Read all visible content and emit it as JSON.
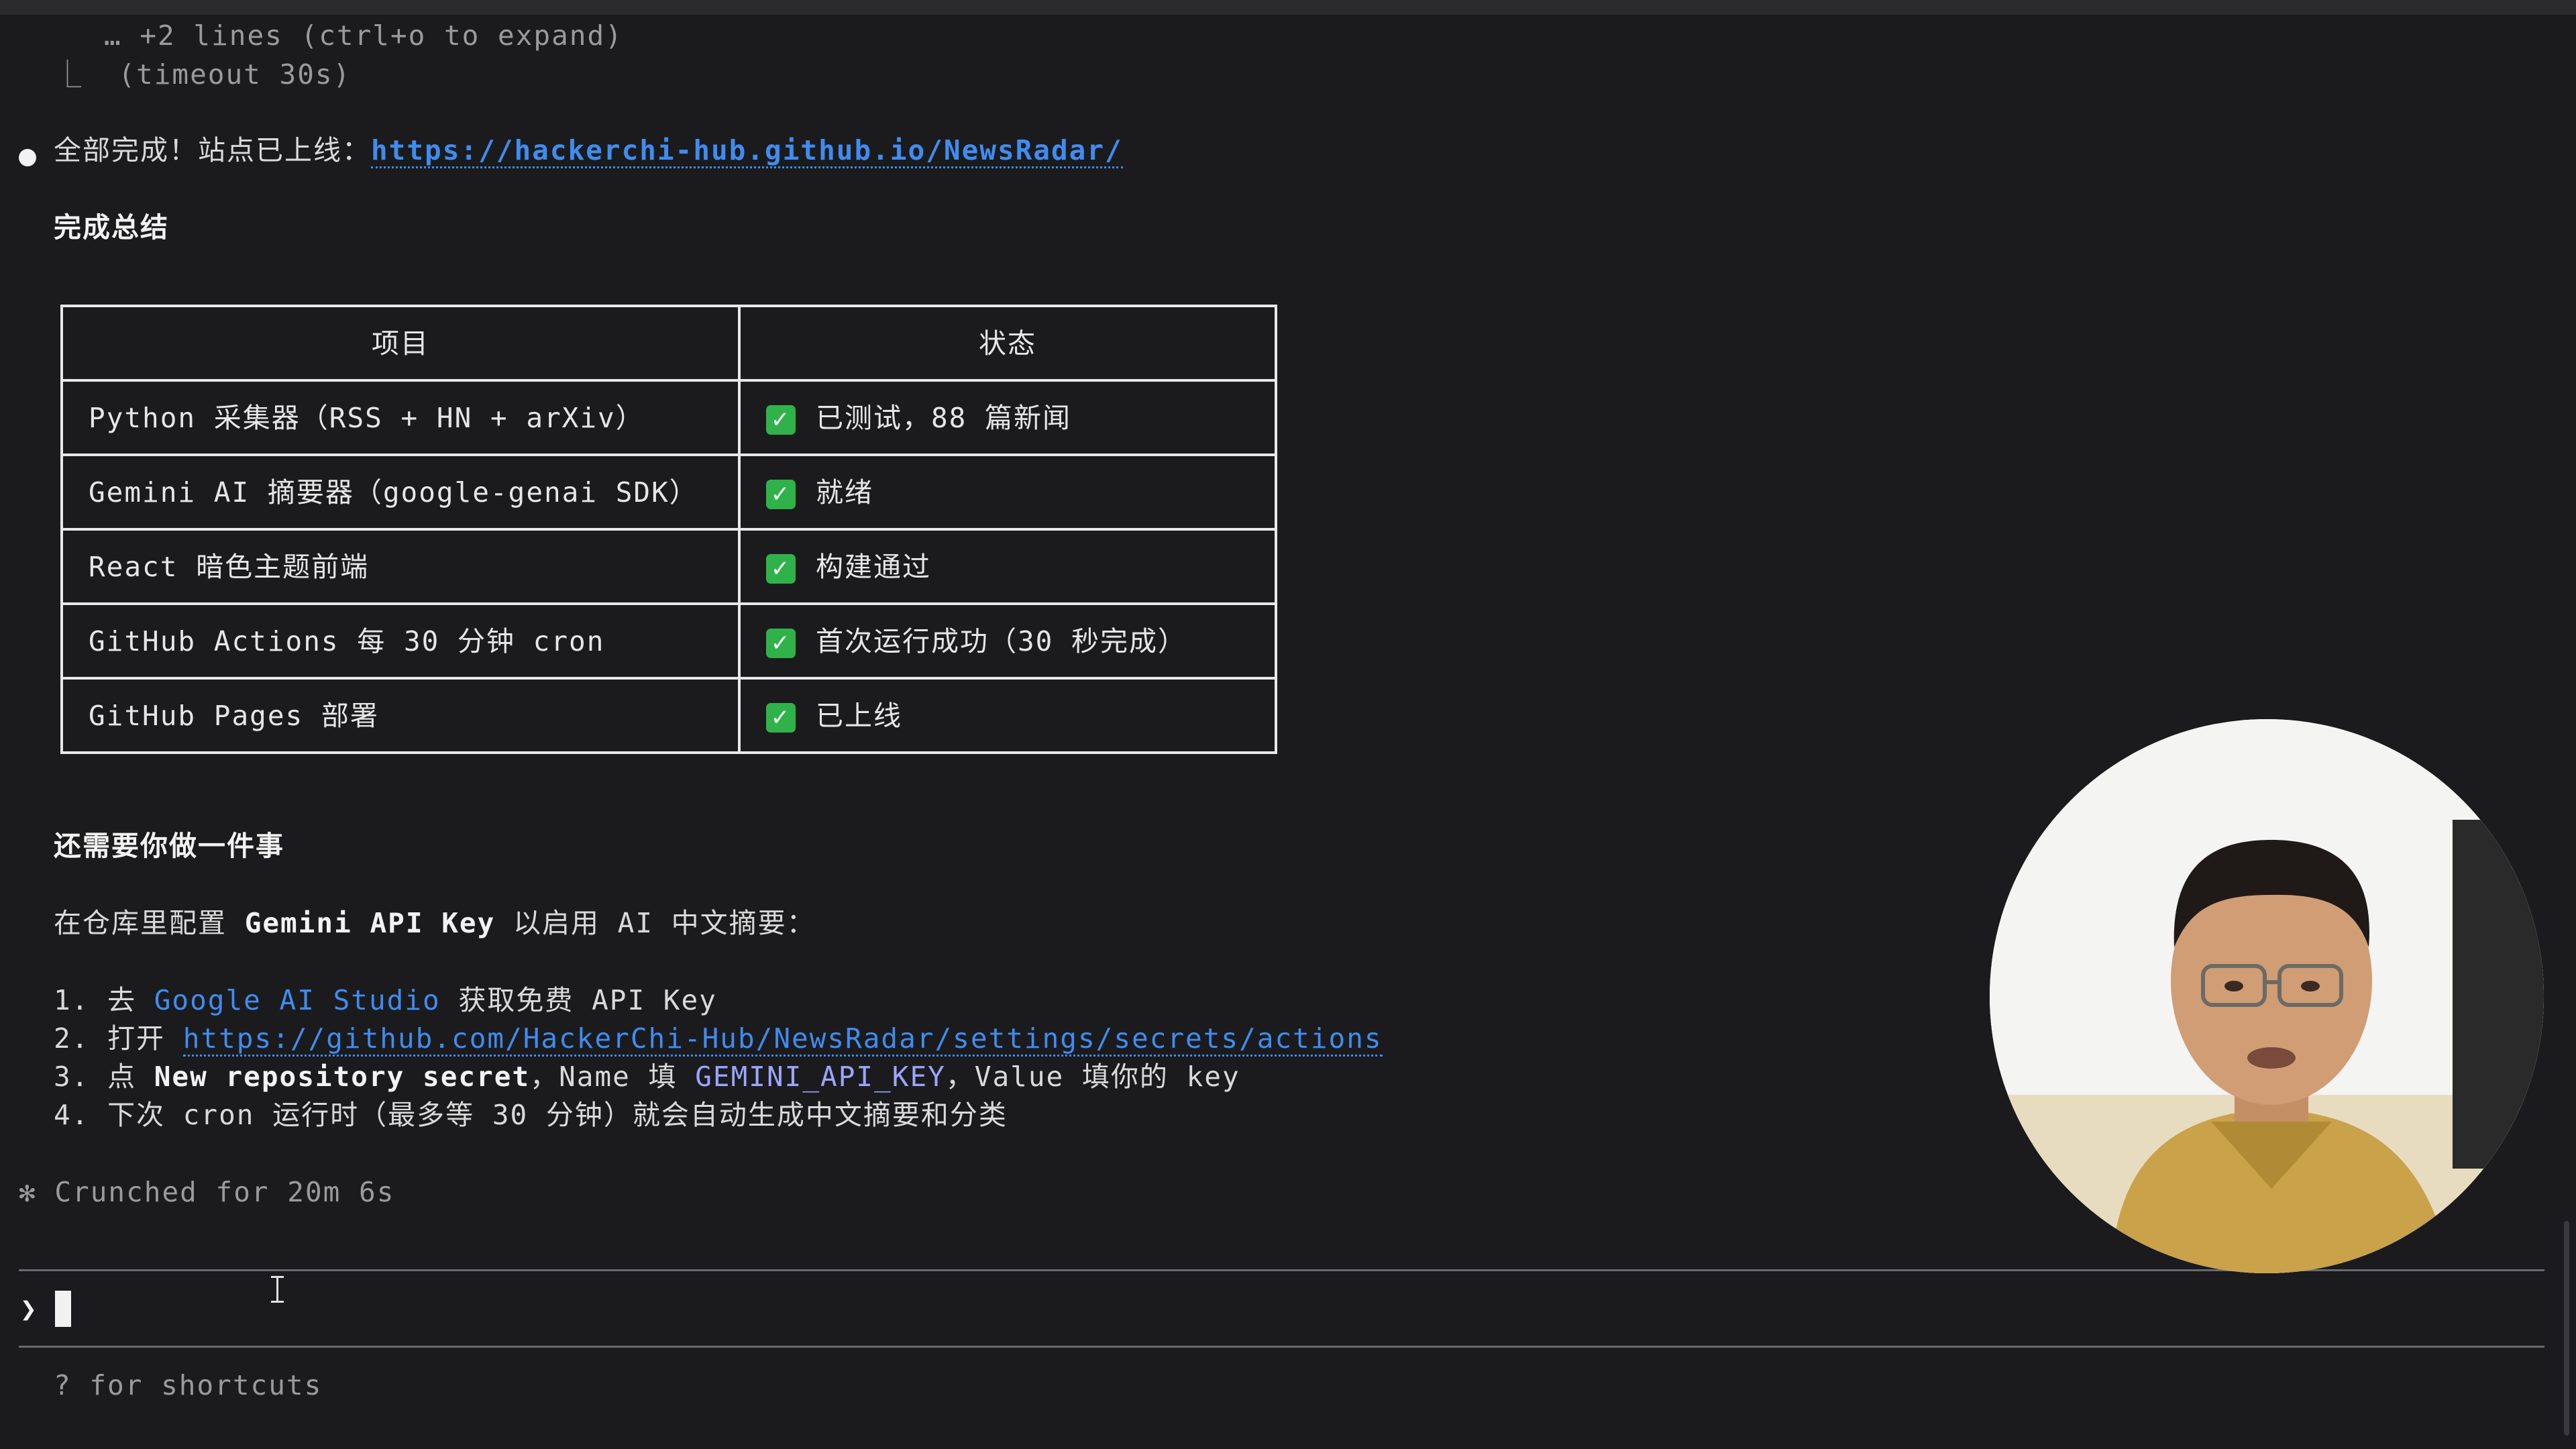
{
  "terminal": {
    "collapsed_text": "… +2 lines (ctrl+o to expand)",
    "timeout_prefix": "⎿",
    "timeout_text": "(timeout 30s)",
    "done_text": "全部完成！站点已上线：",
    "site_url": "https://hackerchi-hub.github.io/NewsRadar/",
    "summary_heading": "完成总结",
    "table": {
      "headers": [
        "项目",
        "状态"
      ],
      "rows": [
        {
          "item": "Python 采集器（RSS + HN + arXiv）",
          "status": "已测试，88 篇新闻"
        },
        {
          "item": "Gemini AI 摘要器（google-genai SDK）",
          "status": "就绪"
        },
        {
          "item": "React 暗色主题前端",
          "status": "构建通过"
        },
        {
          "item": "GitHub Actions 每 30 分钟 cron",
          "status": "首次运行成功（30 秒完成）"
        },
        {
          "item": "GitHub Pages 部署",
          "status": "已上线"
        }
      ]
    },
    "todo_heading": "还需要你做一件事",
    "config_line": {
      "pre": "在仓库里配置 ",
      "bold": "Gemini API Key",
      "post": " 以启用 AI 中文摘要："
    },
    "steps": [
      {
        "num": "1.",
        "pre": "去 ",
        "link": "Google AI Studio",
        "post": " 获取免费 API Key"
      },
      {
        "num": "2.",
        "pre": "打开 ",
        "link": "https://github.com/HackerChi-Hub/NewsRadar/settings/secrets/actions"
      },
      {
        "num": "3.",
        "pre": "点 ",
        "bold": "New repository secret",
        "mid": "，Name 填 ",
        "code": "GEMINI_API_KEY",
        "post": "，Value 填你的 key"
      },
      {
        "num": "4.",
        "text": "下次 cron 运行时（最多等 30 分钟）就会自动生成中文摘要和分类"
      }
    ],
    "status_glyph": "✻",
    "status_text": "Crunched for 20m 6s",
    "prompt_symbol": "❯",
    "shortcuts_hint": "? for shortcuts"
  },
  "icons": {
    "check": "white-check-mark-icon",
    "bullet": "record-bullet-icon"
  },
  "colors": {
    "background": "#1b1b1d",
    "link": "#3f8cf0",
    "code": "#9aa6ff",
    "check_green": "#30b24a"
  }
}
